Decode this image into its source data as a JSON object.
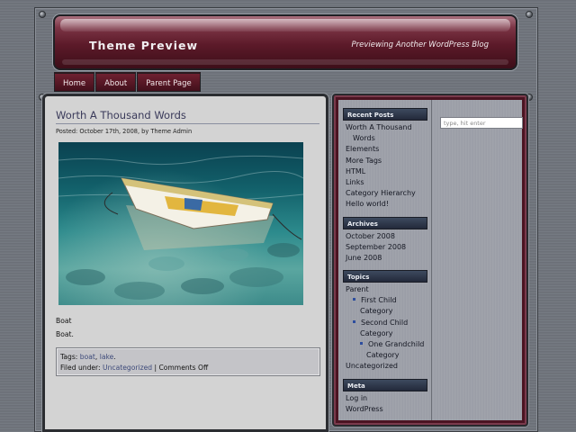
{
  "site": {
    "title": "Theme Preview",
    "description": "Previewing Another WordPress Blog"
  },
  "nav": {
    "items": [
      "Home",
      "About",
      "Parent Page"
    ]
  },
  "post": {
    "title": "Worth A Thousand Words",
    "meta": "Posted: October 17th, 2008, by Theme Admin",
    "image_alt": "boat",
    "paragraphs": [
      "Boat",
      "Boat."
    ],
    "tags_label": "Tags: ",
    "tags": [
      "boat",
      "lake"
    ],
    "tags_sep": ", ",
    "tags_end": ".",
    "filed_label": "Filed under: ",
    "category": "Uncategorized",
    "separator": " | ",
    "comments": "Comments Off"
  },
  "sidebar": {
    "recent_posts": {
      "title": "Recent Posts",
      "items": [
        "Worth A Thousand",
        "Words",
        "Elements",
        "More Tags",
        "HTML",
        "Links",
        "Category Hierarchy",
        "Hello world!"
      ]
    },
    "archives": {
      "title": "Archives",
      "items": [
        "October 2008",
        "September 2008",
        "June 2008"
      ]
    },
    "topics": {
      "title": "Topics",
      "items": [
        "Parent",
        "First Child",
        "Category",
        "Second Child",
        "Category",
        "One Grandchild",
        "Category",
        "Uncategorized"
      ]
    },
    "meta": {
      "title": "Meta",
      "items": [
        "Log in",
        "WordPress"
      ]
    }
  },
  "search": {
    "placeholder": "type, hit enter"
  },
  "colors": {
    "header": "#5c1a29",
    "widget_title": "#3d4a5e",
    "content_bg": "#d3d3d3",
    "sidebar_bg": "#9b9ea7",
    "link": "#3d4a7a"
  }
}
